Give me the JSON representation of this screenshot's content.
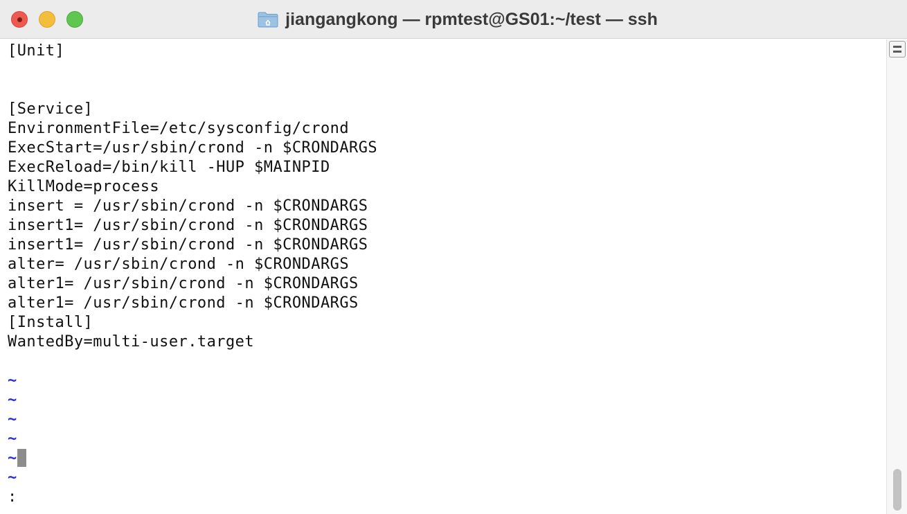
{
  "window": {
    "title": "jiangangkong — rpmtest@GS01:~/test — ssh",
    "title_icon": "folder-icon",
    "controls": [
      "close",
      "minimize",
      "zoom"
    ]
  },
  "editor": {
    "lines": [
      "[Unit]",
      "",
      "",
      "[Service]",
      "EnvironmentFile=/etc/sysconfig/crond",
      "ExecStart=/usr/sbin/crond -n $CRONDARGS",
      "ExecReload=/bin/kill -HUP $MAINPID",
      "KillMode=process",
      "insert = /usr/sbin/crond -n $CRONDARGS",
      "insert1= /usr/sbin/crond -n $CRONDARGS",
      "insert1= /usr/sbin/crond -n $CRONDARGS",
      "alter= /usr/sbin/crond -n $CRONDARGS",
      "alter1= /usr/sbin/crond -n $CRONDARGS",
      "alter1= /usr/sbin/crond -n $CRONDARGS",
      "[Install]",
      "WantedBy=multi-user.target"
    ],
    "empty_marker": "~",
    "empty_marker_count": 6,
    "command_line": ":"
  },
  "colors": {
    "titlebar": "#ececec",
    "close": "#ee5a52",
    "minimize": "#f4bd3c",
    "zoom": "#5fc651",
    "text": "#111111",
    "tilde": "#2a2ad8",
    "cursor": "#8d8d8d"
  }
}
